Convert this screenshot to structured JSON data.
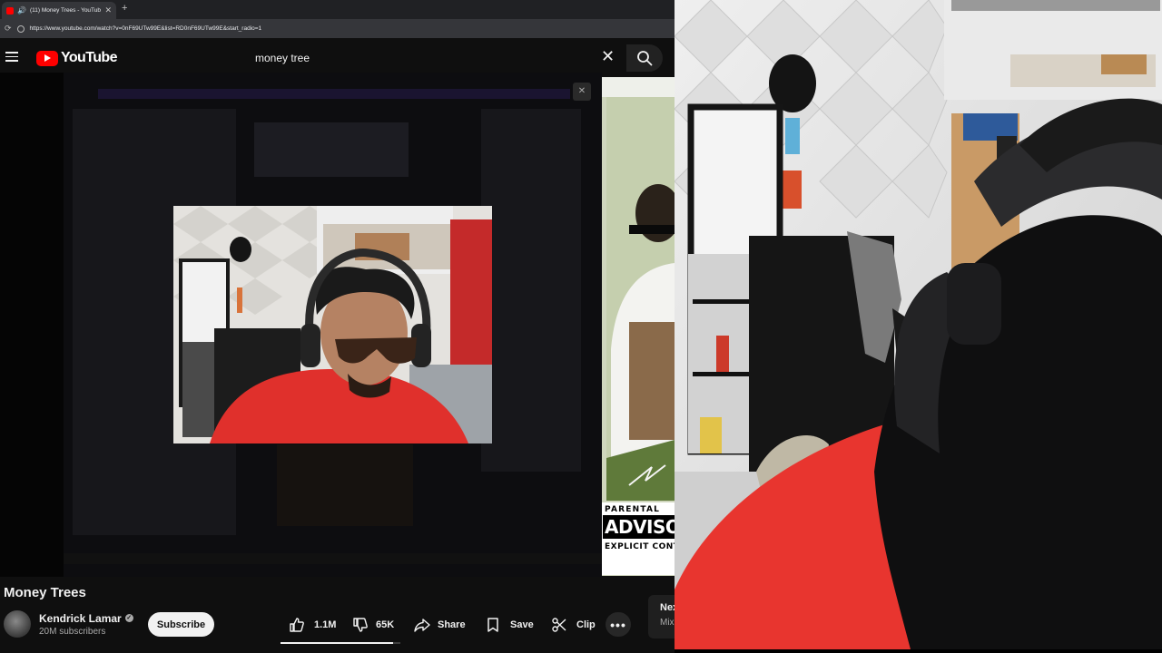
{
  "browser": {
    "tab_title": "(11) Money Trees - YouTube",
    "url": "https://www.youtube.com/watch?v=0nF69UTw99E&list=RD0nF69UTw99E&start_radio=1"
  },
  "header": {
    "logo_text": "YouTube",
    "search_query": "money tree"
  },
  "video": {
    "title": "Money Trees",
    "channel": "Kendrick Lamar",
    "subscribers": "20M subscribers",
    "subscribe_label": "Subscribe",
    "likes": "1.1M",
    "dislikes": "65K",
    "like_ratio": 0.94,
    "share_label": "Share",
    "save_label": "Save",
    "clip_label": "Clip"
  },
  "up_next": {
    "label": "Nex",
    "sub": "Mix"
  },
  "album_art": {
    "advisory_top": "PARENTAL",
    "advisory_middle": "ADVISORY",
    "advisory_bottom": "EXPLICIT CONTENT"
  },
  "colors": {
    "background": "#0f0f0f",
    "brand_red": "#ff0000",
    "webcam_shirt": "#e8352f"
  }
}
